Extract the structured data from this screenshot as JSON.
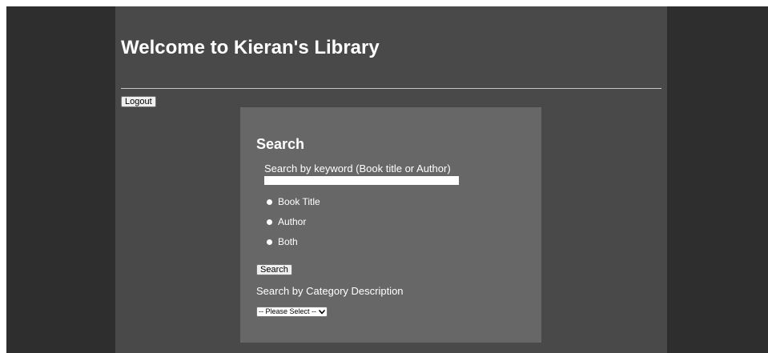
{
  "header": {
    "title": "Welcome to Kieran's Library"
  },
  "toolbar": {
    "logout_label": "Logout"
  },
  "search": {
    "heading": "Search",
    "keyword_label": "Search by keyword (Book title or Author)",
    "keyword_value": "",
    "options": [
      {
        "label": "Book Title"
      },
      {
        "label": "Author"
      },
      {
        "label": "Both"
      }
    ],
    "search_label": "Search",
    "category_label": "Search by Category Description",
    "category_selected": "-- Please Select --"
  },
  "icons": {
    "dropdown": "chevron-down-icon"
  },
  "colors": {
    "outer_background": "#2e2e2e",
    "main_column": "#494949",
    "search_panel": "#676767",
    "text": "#ffffff"
  }
}
